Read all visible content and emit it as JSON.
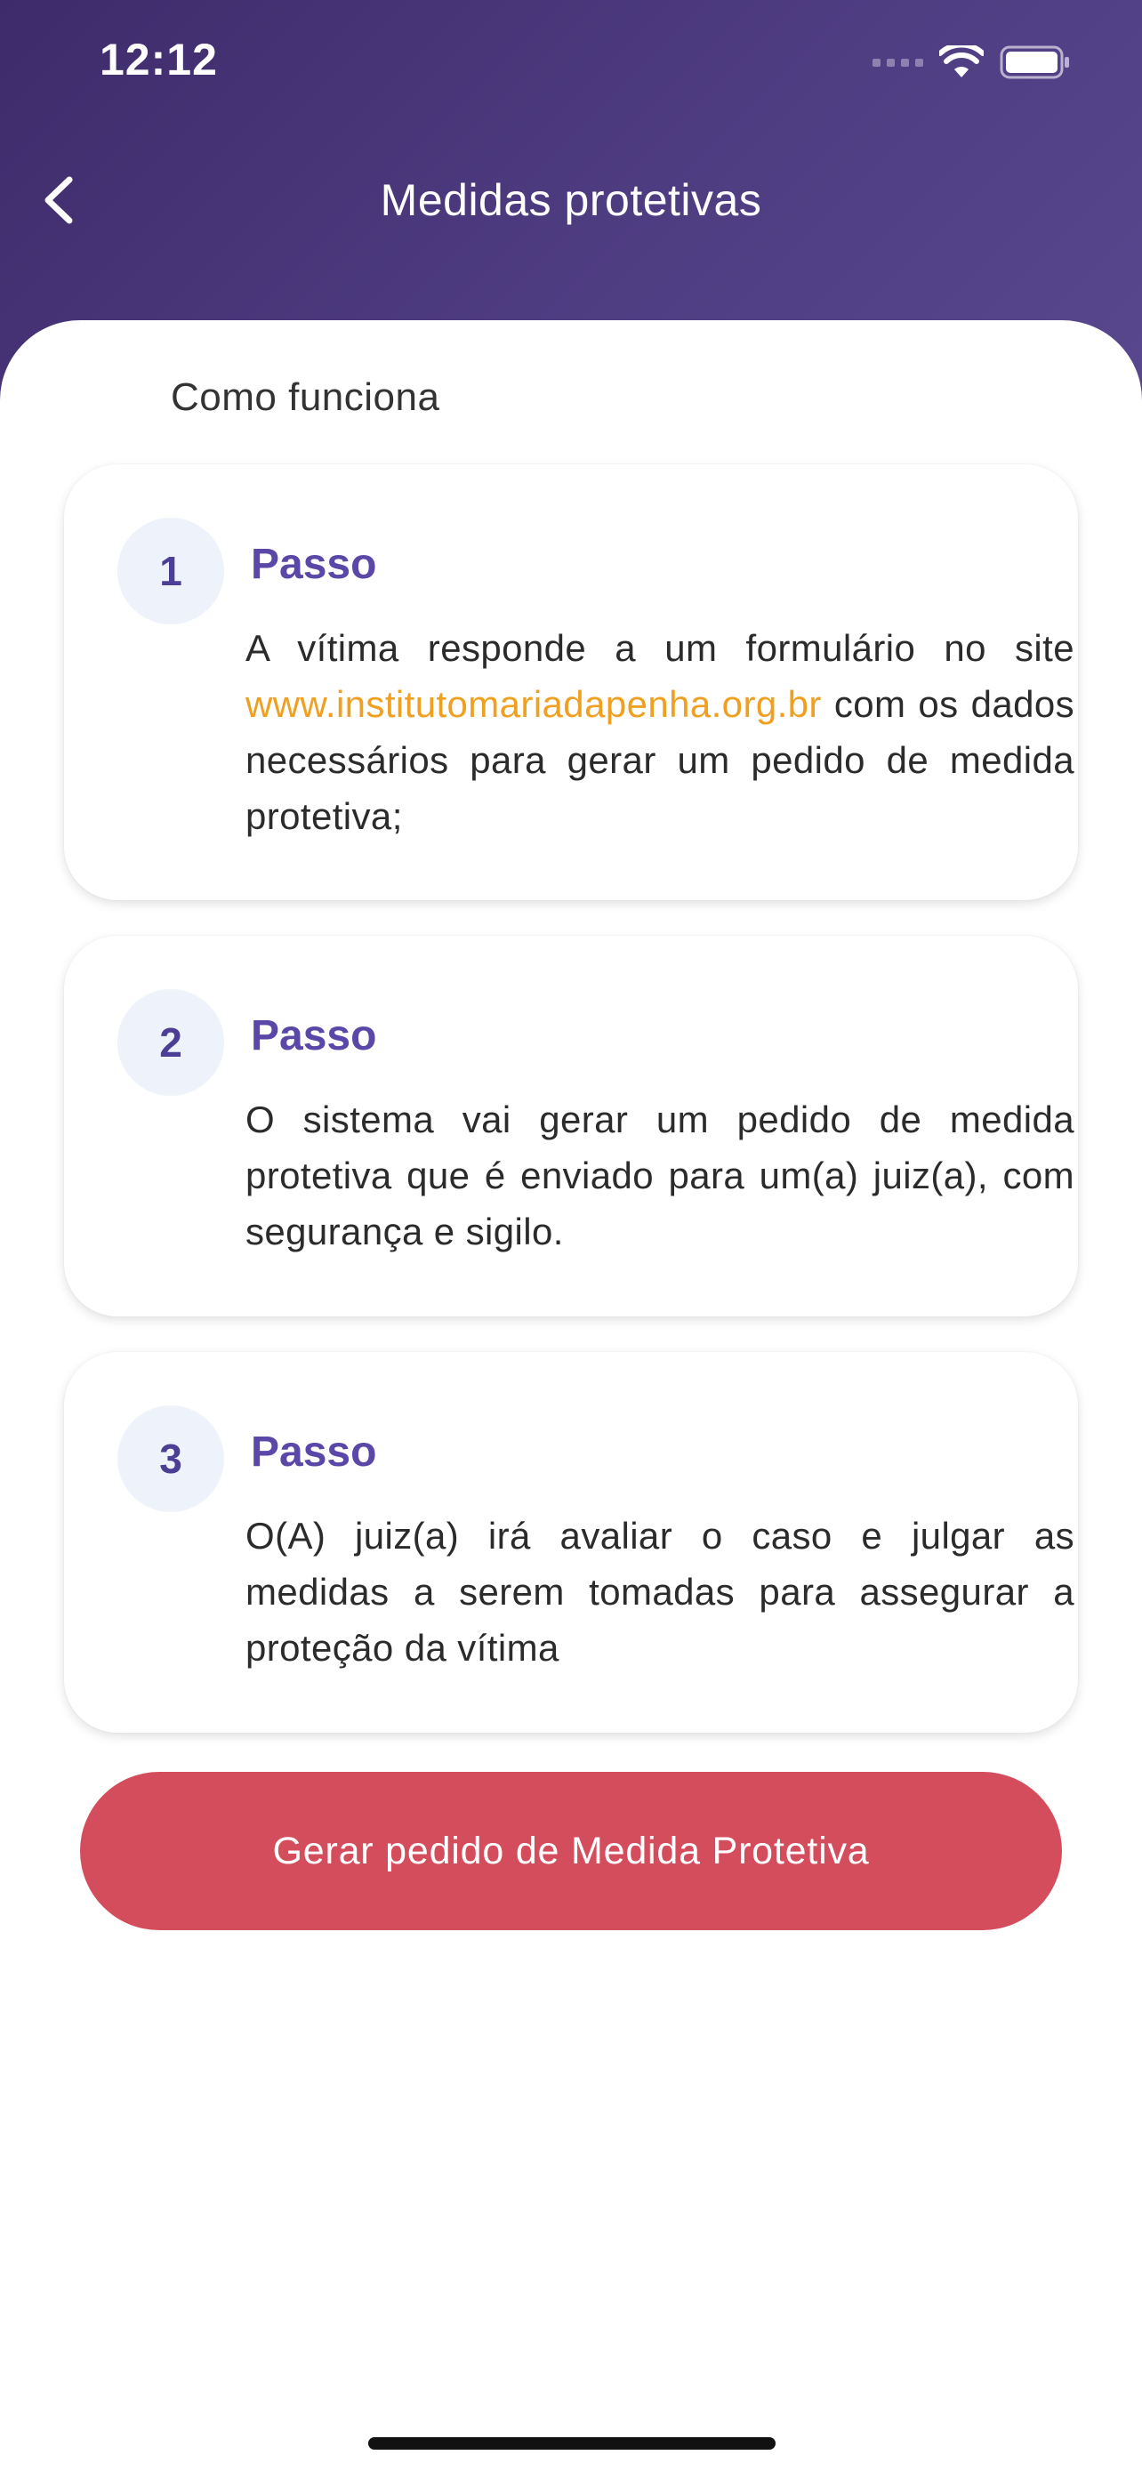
{
  "status_bar": {
    "time": "12:12"
  },
  "nav": {
    "title": "Medidas protetivas"
  },
  "section": {
    "title": "Como funciona"
  },
  "steps": [
    {
      "number": "1",
      "label": "Passo",
      "text_before": "A vítima responde a um formulário no site ",
      "link": "www.institutomariadapenha.org.br",
      "text_after": " com os dados necessários para gerar um pedido de medida protetiva;"
    },
    {
      "number": "2",
      "label": "Passo",
      "text": "O sistema vai gerar um pedido de medida protetiva que é enviado para um(a) juiz(a), com segurança e sigilo."
    },
    {
      "number": "3",
      "label": "Passo",
      "text": "O(A) juiz(a) irá avaliar o caso e julgar as medidas a serem tomadas para assegurar a proteção da vítima"
    }
  ],
  "cta": {
    "label": "Gerar pedido de Medida Protetiva"
  },
  "colors": {
    "header": "#4f3d82",
    "accent": "#5a47a8",
    "link": "#f0a020",
    "cta": "#d44d5c"
  },
  "icons": {
    "back": "chevron-left-icon",
    "wifi": "wifi-icon",
    "battery": "battery-icon"
  }
}
